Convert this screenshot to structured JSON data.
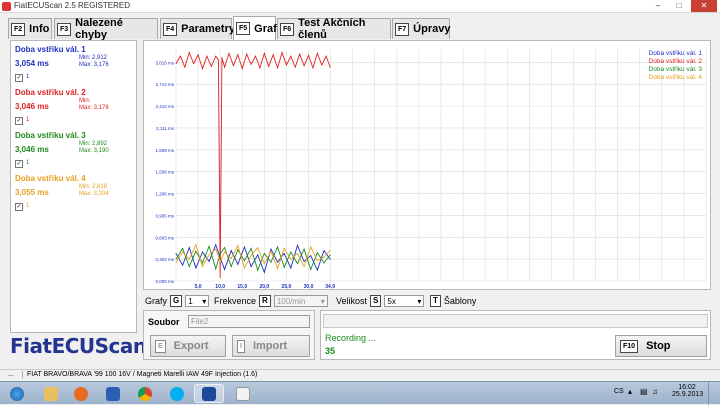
{
  "window": {
    "title": "FiatECUScan 2.5 REGISTERED"
  },
  "tabs": [
    {
      "key": "F2",
      "label": "Info"
    },
    {
      "key": "F3",
      "label": "Nalezené chyby"
    },
    {
      "key": "F4",
      "label": "Parametry"
    },
    {
      "key": "F5",
      "label": "Graf"
    },
    {
      "key": "F6",
      "label": "Test Akčních členů"
    },
    {
      "key": "F7",
      "label": "Úpravy"
    }
  ],
  "active_tab": "Graf",
  "params": [
    {
      "name": "Doba vstřiku vál. 1",
      "value": "3,054 ms",
      "min": "Min: 2,912",
      "max": "Max: 3,176",
      "color": "#1f2fc0",
      "check": "1"
    },
    {
      "name": "Doba vstřiku vál. 2",
      "value": "3,046 ms",
      "min": "Min:",
      "max": "Max: 3,176",
      "color": "#e02020",
      "check": "1"
    },
    {
      "name": "Doba vstřiku vál. 3",
      "value": "3,046 ms",
      "min": "Min: 2,892",
      "max": "Max: 3,190",
      "color": "#1c8a1c",
      "check": "1"
    },
    {
      "name": "Doba vstřiku vál. 4",
      "value": "3,055 ms",
      "min": "Min: 2,818",
      "max": "Max: 3,204",
      "color": "#e8a020",
      "check": "1"
    }
  ],
  "logo": "FiatECUScan",
  "chart_data": {
    "type": "line",
    "y_tick_labels": [
      "3,015 ms",
      "2,714 ms",
      "2,412 ms",
      "2,111 ms",
      "1,809 ms",
      "1,508 ms",
      "1,206 ms",
      "0,905 ms",
      "0,603 ms",
      "0,302 ms",
      "0,000 ms"
    ],
    "y_ticks": [
      3.015,
      2.714,
      2.412,
      2.111,
      1.809,
      1.508,
      1.206,
      0.905,
      0.603,
      0.302,
      0.0
    ],
    "x_tick_labels": [
      "5,0",
      "10,0",
      "15,0",
      "20,0",
      "25,0",
      "30,0",
      "34,9"
    ],
    "x_ticks": [
      5,
      10,
      15,
      20,
      25,
      30,
      34.9
    ],
    "ylim": [
      0,
      3.2
    ],
    "xlim": [
      0,
      120
    ],
    "grid": true,
    "legend_position": "top-right",
    "series": [
      {
        "name": "Doba vstřiku vál. 1",
        "color": "#1f2fc0",
        "x": [
          0,
          1.5,
          3,
          4.5,
          6,
          7.5,
          9,
          10,
          11,
          12.5,
          14,
          15.5,
          17,
          18.5,
          20,
          21.5,
          23,
          24.5,
          26,
          27.5,
          29,
          30.5,
          32,
          33.5,
          34.9
        ],
        "y": [
          0.38,
          0.22,
          0.46,
          0.18,
          0.4,
          0.27,
          0.5,
          0.32,
          0.16,
          0.42,
          0.23,
          0.47,
          0.2,
          0.36,
          0.12,
          0.44,
          0.26,
          0.38,
          0.18,
          0.49,
          0.27,
          0.35,
          0.15,
          0.42,
          0.3
        ]
      },
      {
        "name": "Doba vstřiku vál. 2",
        "color": "#e02020",
        "x": [
          0,
          1,
          2,
          3,
          4,
          5,
          6,
          7,
          8,
          9,
          9.6,
          10,
          10.4,
          11,
          12,
          13,
          14,
          15,
          16,
          17,
          18,
          19,
          20,
          21,
          22,
          23,
          24,
          25,
          26,
          27,
          28,
          29,
          30,
          31,
          32,
          33,
          34,
          34.9
        ],
        "y": [
          3.0,
          3.1,
          2.95,
          3.15,
          3.0,
          3.12,
          2.93,
          3.1,
          2.96,
          3.1,
          3.05,
          0.05,
          3.08,
          2.95,
          3.14,
          2.97,
          3.12,
          2.93,
          3.13,
          2.99,
          3.1,
          2.94,
          3.14,
          2.96,
          3.12,
          2.94,
          3.15,
          2.98,
          3.1,
          2.95,
          3.13,
          2.97,
          3.11,
          2.94,
          3.14,
          2.98,
          3.1,
          2.95
        ]
      },
      {
        "name": "Doba vstřiku vál. 3",
        "color": "#1c8a1c",
        "x": [
          0,
          1.5,
          3,
          4.5,
          6,
          7.5,
          9,
          10,
          11,
          12.5,
          14,
          15.5,
          17,
          18.5,
          20,
          21.5,
          23,
          24.5,
          26,
          27.5,
          29,
          30.5,
          32,
          33.5,
          34.9
        ],
        "y": [
          0.3,
          0.45,
          0.2,
          0.41,
          0.25,
          0.48,
          0.17,
          0.37,
          0.46,
          0.2,
          0.43,
          0.28,
          0.45,
          0.15,
          0.38,
          0.26,
          0.47,
          0.19,
          0.4,
          0.24,
          0.44,
          0.16,
          0.39,
          0.25,
          0.36
        ]
      },
      {
        "name": "Doba vstřiku vál. 4",
        "color": "#e8a020",
        "x": [
          0,
          1.5,
          3,
          4.5,
          6,
          7.5,
          9,
          10,
          11,
          12.5,
          14,
          15.5,
          17,
          18.5,
          20,
          21.5,
          23,
          24.5,
          26,
          27.5,
          29,
          30.5,
          32,
          33.5,
          34.9
        ],
        "y": [
          0.25,
          0.4,
          0.3,
          0.5,
          0.2,
          0.36,
          0.44,
          0.27,
          0.4,
          0.31,
          0.49,
          0.18,
          0.35,
          0.46,
          0.24,
          0.41,
          0.17,
          0.45,
          0.3,
          0.38,
          0.2,
          0.47,
          0.28,
          0.33,
          0.42
        ]
      }
    ]
  },
  "controls": {
    "grafy_label": "Grafy",
    "grafy_key": "G",
    "grafy_value": "1",
    "frekvence_label": "Frekvence",
    "frekvence_key": "R",
    "frekvence_value": "100/min",
    "velikost_label": "Velikost",
    "velikost_key": "S",
    "velikost_value": "5x",
    "sablony_key": "T",
    "sablony_label": "Šablony"
  },
  "file": {
    "label": "Soubor",
    "value": "File2"
  },
  "buttons": {
    "export_key": "E",
    "export_label": "Export",
    "import_key": "I",
    "import_label": "Import",
    "stop_key": "F10",
    "stop_label": "Stop"
  },
  "status": {
    "recording": "Recording ...",
    "count": "35"
  },
  "bottombar": {
    "dots": "...",
    "vehicle": "FIAT BRAVO/BRAVA '99 100 16V / Magneti Marelli IAW 49F Injection (1.6)"
  },
  "taskbar": {
    "lang": "CS",
    "time": "16:02",
    "date": "25.9.2013"
  },
  "colors": {
    "logo": "#24348f",
    "stop_active": "#000000"
  }
}
